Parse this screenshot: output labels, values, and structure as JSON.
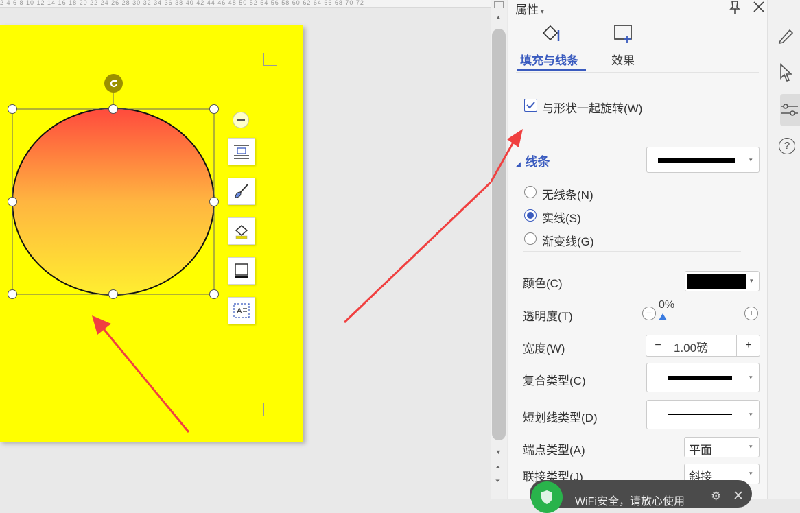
{
  "ruler": {
    "ticks": "2 4 6 8 10 12 14 16 18 20 22 24 26 28 30 32 34 36 38 40 42 44 46 48 50 52 54 56 58 60 62 64 66 68 70 72"
  },
  "panel": {
    "title": "属性",
    "tabs": [
      {
        "label": "填充与线条",
        "active": true
      },
      {
        "label": "效果",
        "active": false
      }
    ],
    "rotate_with_shape": {
      "label": "与形状一起旋转(W)",
      "checked": true
    },
    "line_section": {
      "title": "线条"
    },
    "line_options": [
      {
        "label": "无线条(N)",
        "selected": false
      },
      {
        "label": "实线(S)",
        "selected": true
      },
      {
        "label": "渐变线(G)",
        "selected": false
      }
    ],
    "color": {
      "label": "颜色(C)",
      "value_color": "#000000"
    },
    "transparency": {
      "label": "透明度(T)",
      "value": "0%",
      "minus": "−",
      "plus": "+"
    },
    "width": {
      "label": "宽度(W)",
      "value": "1.00磅",
      "minus": "−",
      "plus": "+"
    },
    "compound_type": {
      "label": "复合类型(C)"
    },
    "dash_type": {
      "label": "短划线类型(D)"
    },
    "cap_type": {
      "label": "端点类型(A)",
      "value": "平面"
    },
    "join_type": {
      "label": "联接类型(J)",
      "value": "斜接"
    }
  },
  "toast": {
    "text": "WiFi安全，请放心使用"
  },
  "colors": {
    "page_background": "#ffff00",
    "accent_blue": "#3a5bbf",
    "annotation_red": "#f04040",
    "circle_top": "#ff4a3d",
    "circle_bottom": "#ffee30"
  }
}
